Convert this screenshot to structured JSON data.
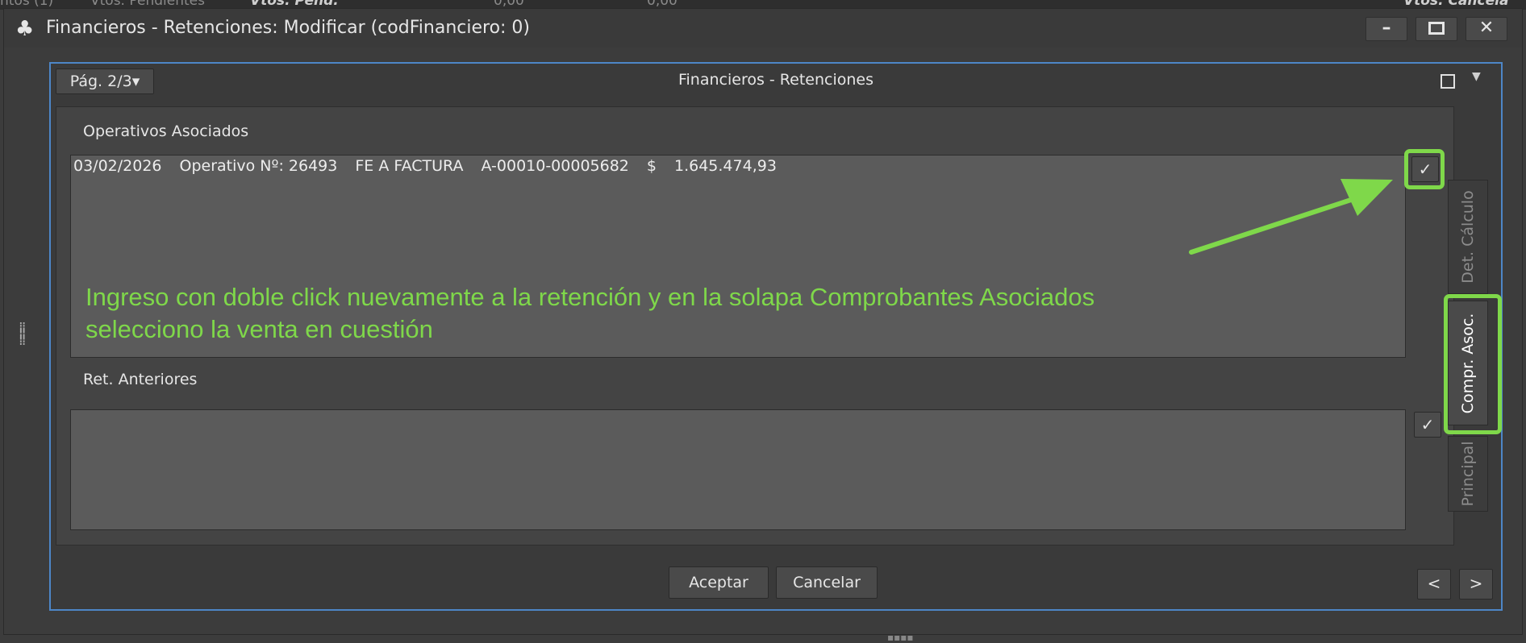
{
  "background": {
    "items": [
      "ntos (1)",
      "Vtos. Pendientes",
      "Vtos. Pend.",
      "0,00",
      "0,00",
      "Vtos. Cancela"
    ]
  },
  "window": {
    "title": "Financieros - Retenciones: Modificar (codFinanciero: 0)",
    "minimize_icon": "minimize-icon",
    "maximize_icon": "maximize-icon",
    "close_icon": "close-icon"
  },
  "panel": {
    "page_selector": "Pág. 2/3▾",
    "title": "Financieros - Retenciones"
  },
  "sections": {
    "operativos_label": "Operativos Asociados",
    "operativos_rows": [
      {
        "date": "03/02/2026",
        "operativo": "Operativo Nº: 26493",
        "tipo": "FE A FACTURA",
        "numero": "A-00010-00005682",
        "currency": "$",
        "amount": "1.645.474,93"
      }
    ],
    "ret_label": "Ret. Anteriores",
    "check_glyph": "✓"
  },
  "tabs": [
    {
      "label": "Det. Cálculo",
      "active": false
    },
    {
      "label": "Compr. Asoc.",
      "active": true
    },
    {
      "label": "Principal",
      "active": false
    }
  ],
  "annotation": {
    "line1": "Ingreso con doble click nuevamente a la retención y en la solapa Comprobantes Asociados",
    "line2": "selecciono la venta en cuestión",
    "color": "#7fd84a"
  },
  "buttons": {
    "accept": "Aceptar",
    "cancel": "Cancelar",
    "prev": "<",
    "next": ">"
  },
  "colors": {
    "highlight": "#7fd84a",
    "panel_border": "#4d86c7",
    "window_bg": "#3c3c3c",
    "list_bg": "#5b5b5b"
  }
}
